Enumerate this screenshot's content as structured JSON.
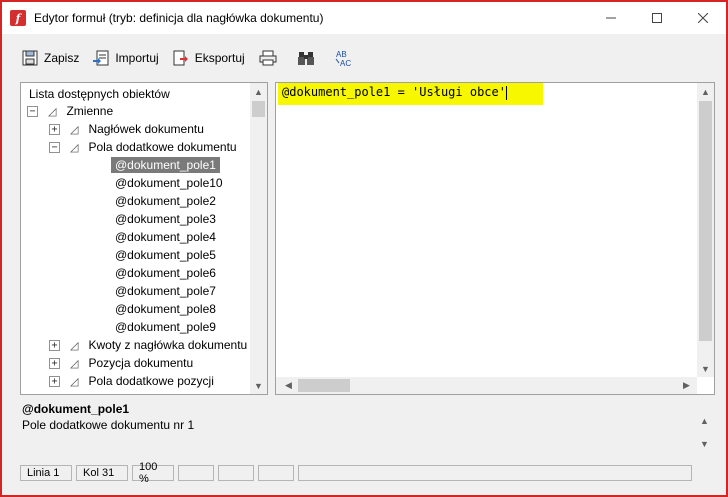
{
  "window": {
    "title": "Edytor formuł (tryb: definicja dla nagłówka dokumentu)",
    "app_icon_letter": "f",
    "controls": {
      "minimize": "—",
      "maximize": "☐",
      "close": "✕"
    }
  },
  "toolbar": {
    "save_label": "Zapisz",
    "import_label": "Importuj",
    "export_label": "Eksportuj",
    "print_icon": "printer-icon",
    "find_icon": "binoculars-icon",
    "spellcheck_icon": "spellcheck-icon"
  },
  "tree": {
    "header": "Lista dostępnych obiektów",
    "root": {
      "label": "Zmienne",
      "toggle": "−"
    },
    "groups": [
      {
        "label": "Nagłówek dokumentu",
        "toggle": "+"
      },
      {
        "label": "Pola dodatkowe dokumentu",
        "toggle": "−"
      }
    ],
    "fields": [
      "@dokument_pole1",
      "@dokument_pole10",
      "@dokument_pole2",
      "@dokument_pole3",
      "@dokument_pole4",
      "@dokument_pole5",
      "@dokument_pole6",
      "@dokument_pole7",
      "@dokument_pole8",
      "@dokument_pole9"
    ],
    "selected_field": "@dokument_pole1",
    "more_groups": [
      {
        "label": "Kwoty z nagłówka dokumentu",
        "toggle": "+"
      },
      {
        "label": "Pozycja dokumentu",
        "toggle": "+"
      },
      {
        "label": "Pola dodatkowe pozycji",
        "toggle": "+"
      }
    ]
  },
  "editor": {
    "code": "@dokument_pole1 = 'Usługi obce'",
    "highlight_color": "#f7f700"
  },
  "description": {
    "title": "@dokument_pole1",
    "text": "Pole dodatkowe dokumentu nr 1"
  },
  "statusbar": {
    "line": "Linia  1",
    "col": "Kol  31",
    "zoom": "100 %"
  },
  "colors": {
    "window_border": "#d42424",
    "selection": "#7a7a7a",
    "app_icon": "#d32f2f"
  }
}
